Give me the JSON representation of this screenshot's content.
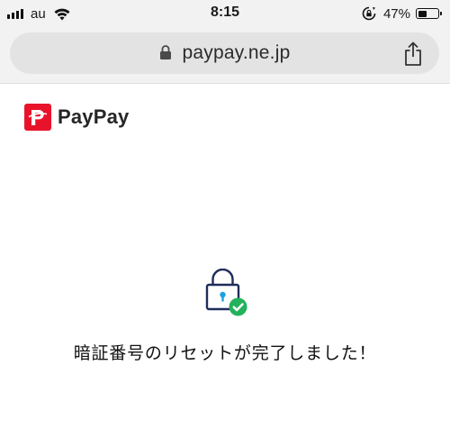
{
  "status_bar": {
    "carrier": "au",
    "time": "8:15",
    "battery_percent": "47%",
    "battery_level": 0.47,
    "icons": [
      "signal-icon",
      "wifi-icon",
      "rotation-lock-icon",
      "battery-icon"
    ]
  },
  "browser": {
    "url": "paypay.ne.jp",
    "icons": [
      "lock-icon",
      "share-icon"
    ]
  },
  "page": {
    "logo_text": "PayPay",
    "brand_color": "#e8132b",
    "message": "暗証番号のリセットが完了しました！",
    "illustration": "lock-with-checkmark-icon",
    "accent_colors": {
      "lock_outline": "#1f2d5a",
      "keyhole": "#1aa3e0",
      "check": "#21b25b"
    }
  }
}
